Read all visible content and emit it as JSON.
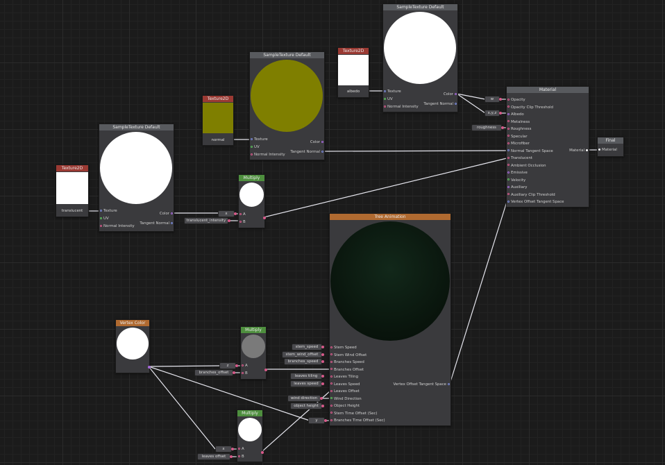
{
  "colors": {
    "background": "#1b1b1b",
    "node_body": "#3a3a3d",
    "header_gray": "#585a5e",
    "header_red": "#9b3a33",
    "header_green": "#4e8f3e",
    "header_orange": "#b06a30",
    "wire": "#e8e8f0",
    "olive_preview": "#7f7f00",
    "dark_green_preview": "#0c170e"
  },
  "nodes": {
    "tex2d_translucent": {
      "title": "Texture2D",
      "name": "translucent"
    },
    "tex2d_normal": {
      "title": "Texture2D",
      "name": "normal"
    },
    "tex2d_albedo": {
      "title": "Texture2D",
      "name": "albedo"
    },
    "sample_translucent": {
      "title": "SampleTexture Default",
      "inputs": [
        "Texture",
        "UV",
        "Normal Intensity"
      ],
      "outputs": [
        "Color",
        "Tangent Normal"
      ]
    },
    "sample_normal": {
      "title": "SampleTexture Default",
      "inputs": [
        "Texture",
        "UV",
        "Normal Intensity"
      ],
      "outputs": [
        "Color",
        "Tangent Normal"
      ]
    },
    "sample_albedo": {
      "title": "SampleTexture Default",
      "inputs": [
        "Texture",
        "UV",
        "Normal Intensity"
      ],
      "outputs": [
        "Color",
        "Tangent Normal"
      ]
    },
    "multiply_top": {
      "title": "Multiply",
      "inputs": [
        "A",
        "B"
      ]
    },
    "multiply_mid": {
      "title": "Multiply",
      "inputs": [
        "A",
        "B"
      ]
    },
    "multiply_bottom": {
      "title": "Multiply",
      "inputs": [
        "A",
        "B"
      ]
    },
    "vertex_color": {
      "title": "Vertex Color"
    },
    "tree_animation": {
      "title": "Tree Animation",
      "inputs": [
        "Stem Speed",
        "Stem Wind Offset",
        "Branches Speed",
        "Branches Offset",
        "Leaves Tiling",
        "Leaves Speed",
        "Leaves Offset",
        "Wind Direction",
        "Object Height",
        "Stem Time Offset (Sec)",
        "Branches Time Offset (Sec)"
      ],
      "outputs": [
        "Vertex Offset Tangent Space"
      ]
    },
    "material": {
      "title": "Material",
      "inputs": [
        "Opacity",
        "Opacity Clip Threshold",
        "Albedo",
        "Metalness",
        "Roughness",
        "Specular",
        "Microfiber",
        "Normal Tangent Space",
        "Translucent",
        "Ambient Occlusion",
        "Emissive",
        "Velocity",
        "Auxiliary",
        "Auxiliary Clip Threshold",
        "Vertex Offset Tangent Space"
      ],
      "outputs": [
        "Material"
      ]
    },
    "final": {
      "title": "Final",
      "inputs": [
        "Material"
      ]
    }
  },
  "properties": {
    "w": "w",
    "xyz": "x,y,z",
    "roughness": "roughness",
    "x_top": "x",
    "translucent_intensity": "translucent_intensity",
    "stem_speed": "stem_speed",
    "stem_wind_offset": "stem_wind_offset",
    "branches_speed": "branches_speed",
    "leaves_tiling": "leaves tiling",
    "leaves_speed": "leaves speed",
    "wind_direction": "wind direction",
    "object_height": "object height",
    "y": "y",
    "z": "z",
    "branches_offset": "branches_offset",
    "x_bottom": "x",
    "leaves_offset": "leaves offset"
  }
}
